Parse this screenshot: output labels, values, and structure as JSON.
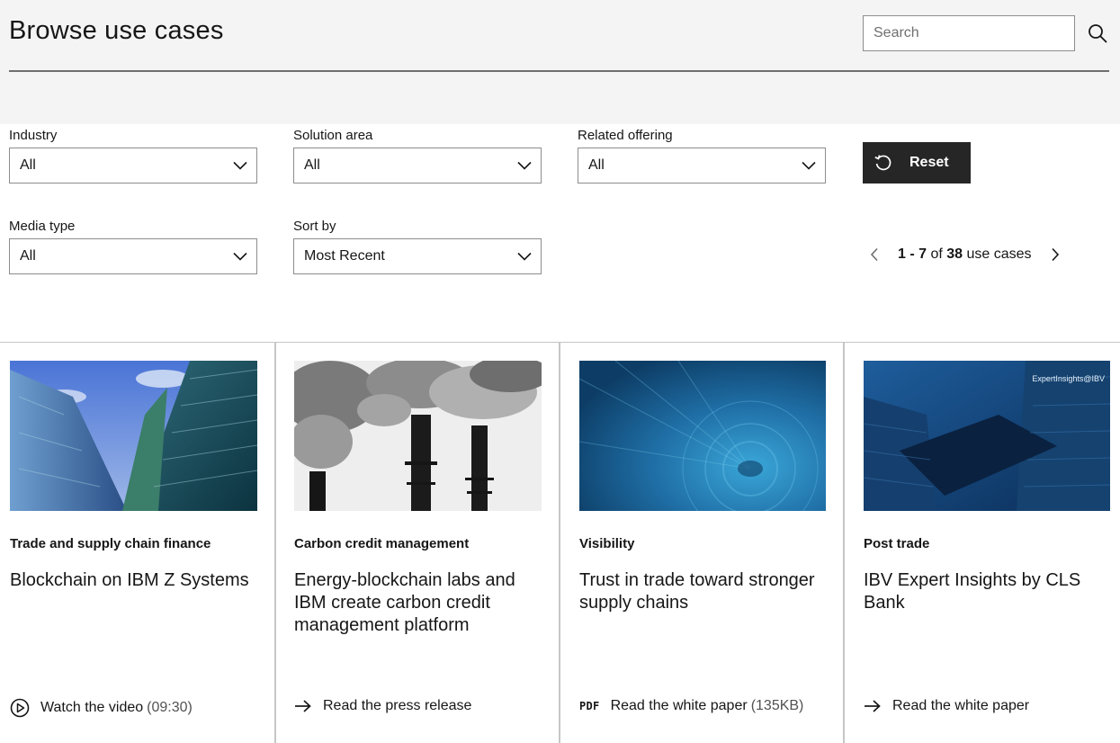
{
  "header": {
    "title": "Browse use cases",
    "search_placeholder": "Search"
  },
  "filters": [
    {
      "label": "Industry",
      "value": "All"
    },
    {
      "label": "Solution area",
      "value": "All"
    },
    {
      "label": "Related offering",
      "value": "All"
    },
    {
      "label": "Media type",
      "value": "All"
    },
    {
      "label": "Sort by",
      "value": "Most Recent"
    }
  ],
  "reset": {
    "label": "Reset"
  },
  "pagination": {
    "range": "1 - 7",
    "of": "of",
    "total": "38",
    "unit": "use cases"
  },
  "cards": [
    {
      "category": "Trade and supply chain finance",
      "title": "Blockchain on IBM Z Systems",
      "link_icon": "play-circle-icon",
      "link_label": "Watch the video",
      "link_meta": "(09:30)"
    },
    {
      "category": "Carbon credit management",
      "title": "Energy-blockchain labs and IBM create carbon credit management platform",
      "link_icon": "arrow-right-icon",
      "link_label": "Read the press release",
      "link_meta": ""
    },
    {
      "category": "Visibility",
      "title": "Trust in trade toward stronger supply chains",
      "link_icon": "pdf-icon",
      "link_badge": "PDF",
      "link_label": "Read the white paper",
      "link_meta": "(135KB)"
    },
    {
      "category": "Post trade",
      "title": "IBV Expert Insights by CLS Bank",
      "image_caption": "ExpertInsights@IBV",
      "link_icon": "arrow-right-icon",
      "link_label": "Read the white paper",
      "link_meta": ""
    }
  ],
  "colors": {
    "header_background": "#f4f4f4",
    "reset_button": "#262626",
    "text": "#161616",
    "border": "#8d8d8d"
  }
}
